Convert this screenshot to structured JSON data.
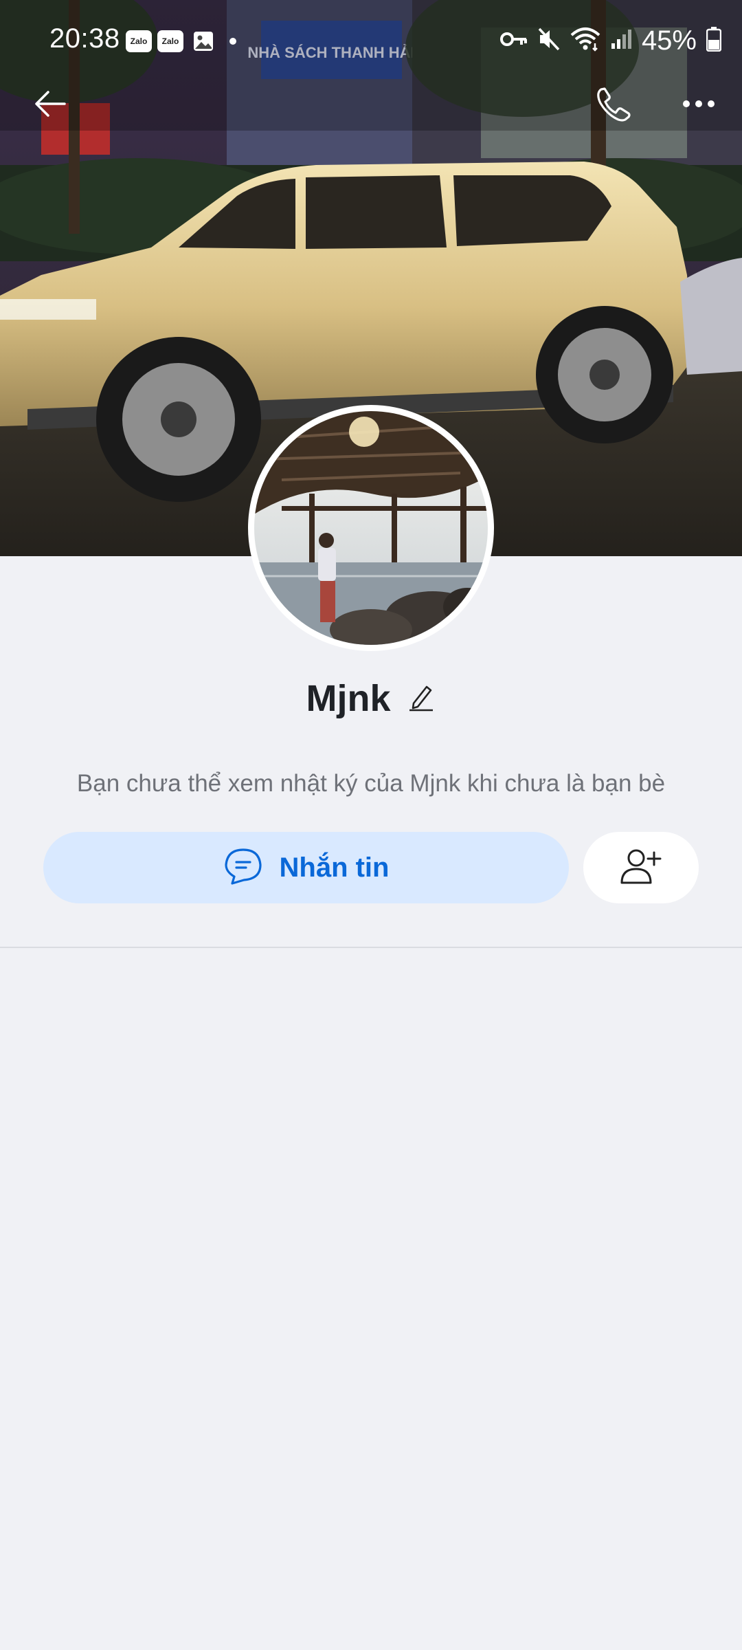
{
  "status_bar": {
    "time": "20:38",
    "notification_icons": [
      "zalo-icon",
      "zalo-icon",
      "gallery-icon",
      "dot-icon"
    ],
    "zalo_badge_text": "Zalo",
    "system_icons": [
      "vpn-key-icon",
      "mute-icon",
      "wifi-icon",
      "signal-icon",
      "battery-icon"
    ],
    "battery_percent": "45%"
  },
  "top_bar": {
    "back_icon": "back-arrow-icon",
    "call_icon": "phone-icon",
    "more_icon": "more-dots-icon"
  },
  "cover": {
    "signboard_text": "NHÀ SÁCH THANH HẢI"
  },
  "profile": {
    "name": "Mjnk",
    "privacy_note": "Bạn chưa thể xem nhật ký của Mjnk khi chưa là bạn bè"
  },
  "actions": {
    "message_label": "Nhắn tin",
    "message_icon": "chat-bubble-icon",
    "add_friend_icon": "add-friend-icon"
  },
  "colors": {
    "background": "#f0f1f5",
    "primary_blue": "#0a68d8",
    "message_button_bg": "#d9e9ff",
    "text_dark": "#1f2227",
    "text_muted": "#6e7178"
  }
}
